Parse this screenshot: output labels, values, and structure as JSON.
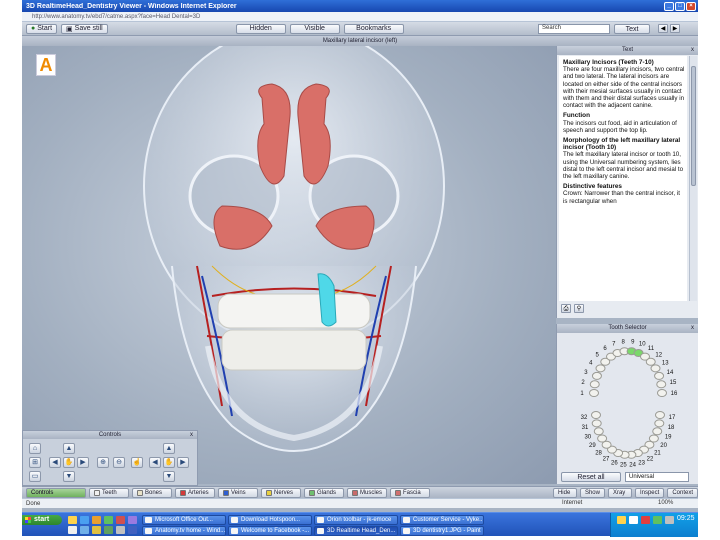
{
  "window": {
    "title": "3D RealtimeHead_Dentistry Viewer - Windows Internet Explorer",
    "address": "http://www.anatomy.tv/ebd7/catme.aspx?face=Head Dental=3D"
  },
  "toolbar": {
    "start_label": "Start",
    "save_label": "Save still",
    "hidden_label": "Hidden",
    "visible_label": "Visible",
    "bookmarks_label": "Bookmarks",
    "search_value": "Search",
    "text_label": "Text"
  },
  "viewport": {
    "structure_title": "Maxillary lateral incisor (left)",
    "logo": "A"
  },
  "text_panel": {
    "title": "Text",
    "close": "x",
    "heading1": "Maxillary Incisors (Teeth 7-10)",
    "para1": "There are four maxillary incisors, two central and two lateral. The lateral incisors are located on either side of the central incisors with their mesial surfaces usually in contact with them and their distal surfaces usually in contact with the adjacent canine.",
    "heading2": "Function",
    "para2": "The incisors cut food, aid in articulation of speech and support the top lip.",
    "heading3": "Morphology of the left maxillary lateral incisor (Tooth 10)",
    "para3": "The left maxillary lateral incisor or tooth 10, using the Universal numbering system, lies distal to the left central incisor and mesial to the left maxillary canine.",
    "heading4": "Distinctive features",
    "para4": "Crown: Narrower than the central incisor, it is rectangular when"
  },
  "tooth_selector": {
    "title": "Tooth Selector",
    "close": "x",
    "upper_numbers": [
      "6",
      "5",
      "4",
      "3",
      "2",
      "1",
      "7",
      "8",
      "9",
      "10",
      "11",
      "12",
      "13",
      "14",
      "15",
      "16"
    ],
    "lower_numbers": [
      "32",
      "31",
      "30",
      "29",
      "28",
      "27",
      "26",
      "25",
      "24",
      "23",
      "22",
      "21",
      "20",
      "19",
      "18",
      "17"
    ],
    "reset_label": "Reset all",
    "numbering_value": "Universal"
  },
  "controls": {
    "title": "Controls",
    "close": "x"
  },
  "tabs": [
    {
      "label": "Controls",
      "color": "#6fb15e"
    },
    {
      "label": "Teeth",
      "color": "#f0f0f0"
    },
    {
      "label": "Bones",
      "color": "#e8e2c8"
    },
    {
      "label": "Arteries",
      "color": "#d23a3a"
    },
    {
      "label": "Veins",
      "color": "#2f5fd0"
    },
    {
      "label": "Nerves",
      "color": "#e8d040"
    },
    {
      "label": "Glands",
      "color": "#6fbf6f"
    },
    {
      "label": "Muscles",
      "color": "#c86a6a"
    },
    {
      "label": "Fascia",
      "color": "#d07070"
    }
  ],
  "right_tabs": [
    "Hide",
    "Show",
    "Xray",
    "Inspect",
    "Context"
  ],
  "ie_status": {
    "left": "Done",
    "zone": "Internet",
    "zoom": "100%"
  },
  "taskbar": {
    "start": "start",
    "items": [
      "Microsoft Office Out...",
      "Download Hotspoon...",
      "Orion toolbar - jk-emoce",
      "Customer Service - Vyke...",
      "Anatomy.tv home - Wind...",
      "Welcome to Facebook -...",
      "3D Realtime Head_Den...",
      "3D dentistry1.JPG - Paint"
    ],
    "clock": "09:25"
  },
  "colors": {
    "accent": "#2f6fd8",
    "tooth_highlight": "#4fd8e8",
    "gum": "#d96f68"
  }
}
